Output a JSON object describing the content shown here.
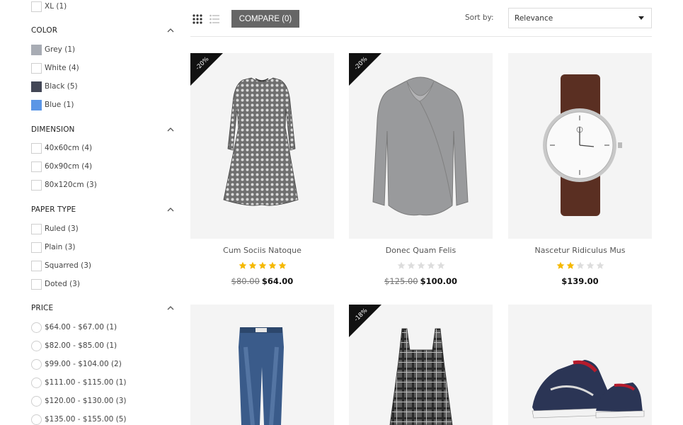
{
  "filters": {
    "size": {
      "items": [
        {
          "label": "XL (1)"
        }
      ]
    },
    "color": {
      "title": "COLOR",
      "items": [
        {
          "label": "Grey (1)",
          "swatch": "#a8acb4"
        },
        {
          "label": "White (4)",
          "swatch": "#ffffff"
        },
        {
          "label": "Black (5)",
          "swatch": "#434756"
        },
        {
          "label": "Blue (1)",
          "swatch": "#5b96e6"
        }
      ]
    },
    "dimension": {
      "title": "DIMENSION",
      "items": [
        {
          "label": "40x60cm (4)"
        },
        {
          "label": "60x90cm (4)"
        },
        {
          "label": "80x120cm (3)"
        }
      ]
    },
    "paper_type": {
      "title": "PAPER TYPE",
      "items": [
        {
          "label": "Ruled (3)"
        },
        {
          "label": "Plain (3)"
        },
        {
          "label": "Squarred (3)"
        },
        {
          "label": "Doted (3)"
        }
      ]
    },
    "price": {
      "title": "PRICE",
      "items": [
        {
          "label": "$64.00 - $67.00 (1)"
        },
        {
          "label": "$82.00 - $85.00 (1)"
        },
        {
          "label": "$99.00 - $104.00 (2)"
        },
        {
          "label": "$111.00 - $115.00 (1)"
        },
        {
          "label": "$120.00 - $130.00 (3)"
        },
        {
          "label": "$135.00 - $155.00 (5)"
        }
      ]
    }
  },
  "toolbar": {
    "grid_icon": "grid-view-icon",
    "list_icon": "list-view-icon",
    "compare_label": "COMPARE (0)",
    "sort_label": "Sort by:",
    "sort_value": "Relevance"
  },
  "products": [
    {
      "name": "Cum Sociis Natoque",
      "badge": "-20%",
      "rating": 5,
      "old_price": "$80.00",
      "price": "$64.00",
      "image": "patterned-dress"
    },
    {
      "name": "Donec Quam Felis",
      "badge": "-20%",
      "rating": 0,
      "old_price": "$125.00",
      "price": "$100.00",
      "image": "grey-sweater"
    },
    {
      "name": "Nascetur Ridiculus Mus",
      "badge": "",
      "rating": 2,
      "old_price": "",
      "price": "$139.00",
      "image": "wrist-watch"
    },
    {
      "name": "",
      "badge": "",
      "rating": null,
      "old_price": "",
      "price": "",
      "image": "blue-jeans"
    },
    {
      "name": "",
      "badge": "-18%",
      "rating": null,
      "old_price": "",
      "price": "",
      "image": "plaid-dress"
    },
    {
      "name": "",
      "badge": "",
      "rating": null,
      "old_price": "",
      "price": "",
      "image": "sneakers"
    }
  ],
  "colors": {
    "star_on": "#f5b800",
    "star_off": "#dddddd",
    "badge_bg": "#111111",
    "compare_bg": "#666666"
  }
}
